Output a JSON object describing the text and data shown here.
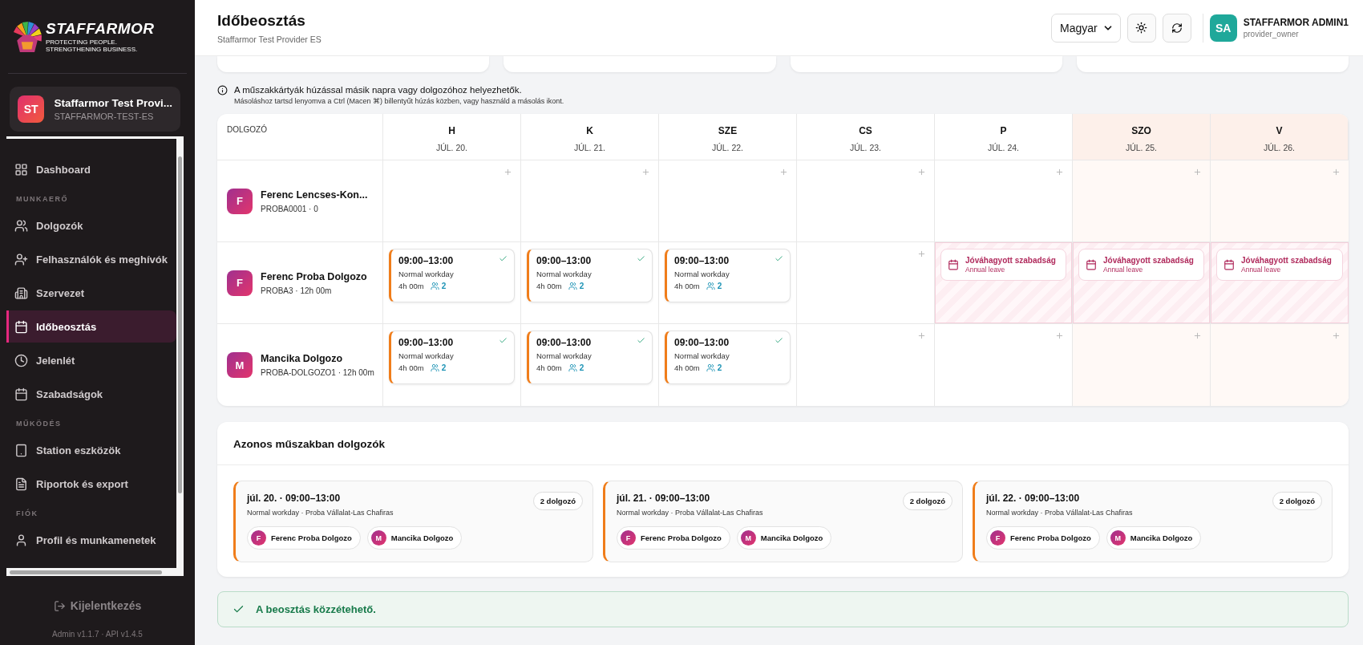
{
  "sidebar": {
    "logo": {
      "name": "STAFFARMOR",
      "tagline": "PROTECTING PEOPLE. STRENGTHENING BUSINESS."
    },
    "org": {
      "initials": "ST",
      "name": "Staffarmor Test Provi...",
      "code": "STAFFARMOR-TEST-ES"
    },
    "nav": [
      {
        "kind": "item",
        "label": "Dashboard",
        "selected": false
      },
      {
        "kind": "section",
        "label": "MUNKAERŐ"
      },
      {
        "kind": "item",
        "label": "Dolgozók",
        "selected": false
      },
      {
        "kind": "item",
        "label": "Felhasználók és meghívók",
        "selected": false
      },
      {
        "kind": "item",
        "label": "Szervezet",
        "selected": false
      },
      {
        "kind": "item",
        "label": "Időbeosztás",
        "selected": true
      },
      {
        "kind": "item",
        "label": "Jelenlét",
        "selected": false
      },
      {
        "kind": "item",
        "label": "Szabadságok",
        "selected": false
      },
      {
        "kind": "section",
        "label": "MŰKÖDÉS"
      },
      {
        "kind": "item",
        "label": "Station eszközök",
        "selected": false
      },
      {
        "kind": "item",
        "label": "Riportok és export",
        "selected": false
      },
      {
        "kind": "section",
        "label": "FIÓK"
      },
      {
        "kind": "item",
        "label": "Profil és munkamenetek",
        "selected": false
      }
    ],
    "logout": "Kijelentkezés",
    "version": "Admin v1.1.7 · API v1.4.5"
  },
  "header": {
    "title": "Időbeosztás",
    "subtitle": "Staffarmor Test Provider ES",
    "language": "Magyar",
    "user": {
      "initials": "SA",
      "name": "STAFFARMOR ADMIN1",
      "role": "provider_owner"
    }
  },
  "notes": {
    "main": "A műszakkártyák húzással másik napra vagy dolgozóhoz helyezhetők.",
    "hint": "Másoláshoz tartsd lenyomva a Ctrl (Macen ⌘) billentyűt húzás közben, vagy használd a másolás ikont."
  },
  "schedule": {
    "employee_header": "DOLGOZÓ",
    "days": [
      {
        "dow": "H",
        "date": "JÚL. 20.",
        "weekend": false
      },
      {
        "dow": "K",
        "date": "JÚL. 21.",
        "weekend": false
      },
      {
        "dow": "SZE",
        "date": "JÚL. 22.",
        "weekend": false
      },
      {
        "dow": "CS",
        "date": "JÚL. 23.",
        "weekend": false
      },
      {
        "dow": "P",
        "date": "JÚL. 24.",
        "weekend": false
      },
      {
        "dow": "SZO",
        "date": "JÚL. 25.",
        "weekend": true
      },
      {
        "dow": "V",
        "date": "JÚL. 26.",
        "weekend": true
      }
    ],
    "employees": [
      {
        "initial": "F",
        "name": "Ferenc Lencses-Kon...",
        "sub": "PROBA0001 · 0",
        "cells": [
          {
            "kind": "empty"
          },
          {
            "kind": "empty"
          },
          {
            "kind": "empty"
          },
          {
            "kind": "empty"
          },
          {
            "kind": "empty"
          },
          {
            "kind": "empty"
          },
          {
            "kind": "empty"
          }
        ]
      },
      {
        "initial": "F",
        "name": "Ferenc Proba Dolgozo",
        "sub": "PROBA3 · 12h 00m",
        "cells": [
          {
            "kind": "shift",
            "time": "09:00–13:00",
            "type": "Normal workday",
            "duration": "4h 00m",
            "count": "2"
          },
          {
            "kind": "shift",
            "time": "09:00–13:00",
            "type": "Normal workday",
            "duration": "4h 00m",
            "count": "2"
          },
          {
            "kind": "shift",
            "time": "09:00–13:00",
            "type": "Normal workday",
            "duration": "4h 00m",
            "count": "2"
          },
          {
            "kind": "empty"
          },
          {
            "kind": "leave",
            "title": "Jóváhagyott szabadság",
            "subtitle": "Annual leave"
          },
          {
            "kind": "leave",
            "title": "Jóváhagyott szabadság",
            "subtitle": "Annual leave"
          },
          {
            "kind": "leave",
            "title": "Jóváhagyott szabadság",
            "subtitle": "Annual leave"
          }
        ]
      },
      {
        "initial": "M",
        "name": "Mancika Dolgozo",
        "sub": "PROBA-DOLGOZO1 · 12h 00m",
        "cells": [
          {
            "kind": "shift",
            "time": "09:00–13:00",
            "type": "Normal workday",
            "duration": "4h 00m",
            "count": "2"
          },
          {
            "kind": "shift",
            "time": "09:00–13:00",
            "type": "Normal workday",
            "duration": "4h 00m",
            "count": "2"
          },
          {
            "kind": "shift",
            "time": "09:00–13:00",
            "type": "Normal workday",
            "duration": "4h 00m",
            "count": "2"
          },
          {
            "kind": "empty"
          },
          {
            "kind": "empty"
          },
          {
            "kind": "empty"
          },
          {
            "kind": "empty"
          }
        ]
      }
    ]
  },
  "shared": {
    "title": "Azonos műszakban dolgozók",
    "groups": [
      {
        "heading": "júl. 20. · 09:00–13:00",
        "detail": "Normal workday · Proba Vállalat-Las Chafiras",
        "count": "2 dolgozó",
        "people": [
          {
            "initial": "F",
            "name": "Ferenc Proba Dolgozo"
          },
          {
            "initial": "M",
            "name": "Mancika Dolgozo"
          }
        ]
      },
      {
        "heading": "júl. 21. · 09:00–13:00",
        "detail": "Normal workday · Proba Vállalat-Las Chafiras",
        "count": "2 dolgozó",
        "people": [
          {
            "initial": "F",
            "name": "Ferenc Proba Dolgozo"
          },
          {
            "initial": "M",
            "name": "Mancika Dolgozo"
          }
        ]
      },
      {
        "heading": "júl. 22. · 09:00–13:00",
        "detail": "Normal workday · Proba Vállalat-Las Chafiras",
        "count": "2 dolgozó",
        "people": [
          {
            "initial": "F",
            "name": "Ferenc Proba Dolgozo"
          },
          {
            "initial": "M",
            "name": "Mancika Dolgozo"
          }
        ]
      }
    ]
  },
  "banner": {
    "text": "A beosztás közzétehető."
  }
}
